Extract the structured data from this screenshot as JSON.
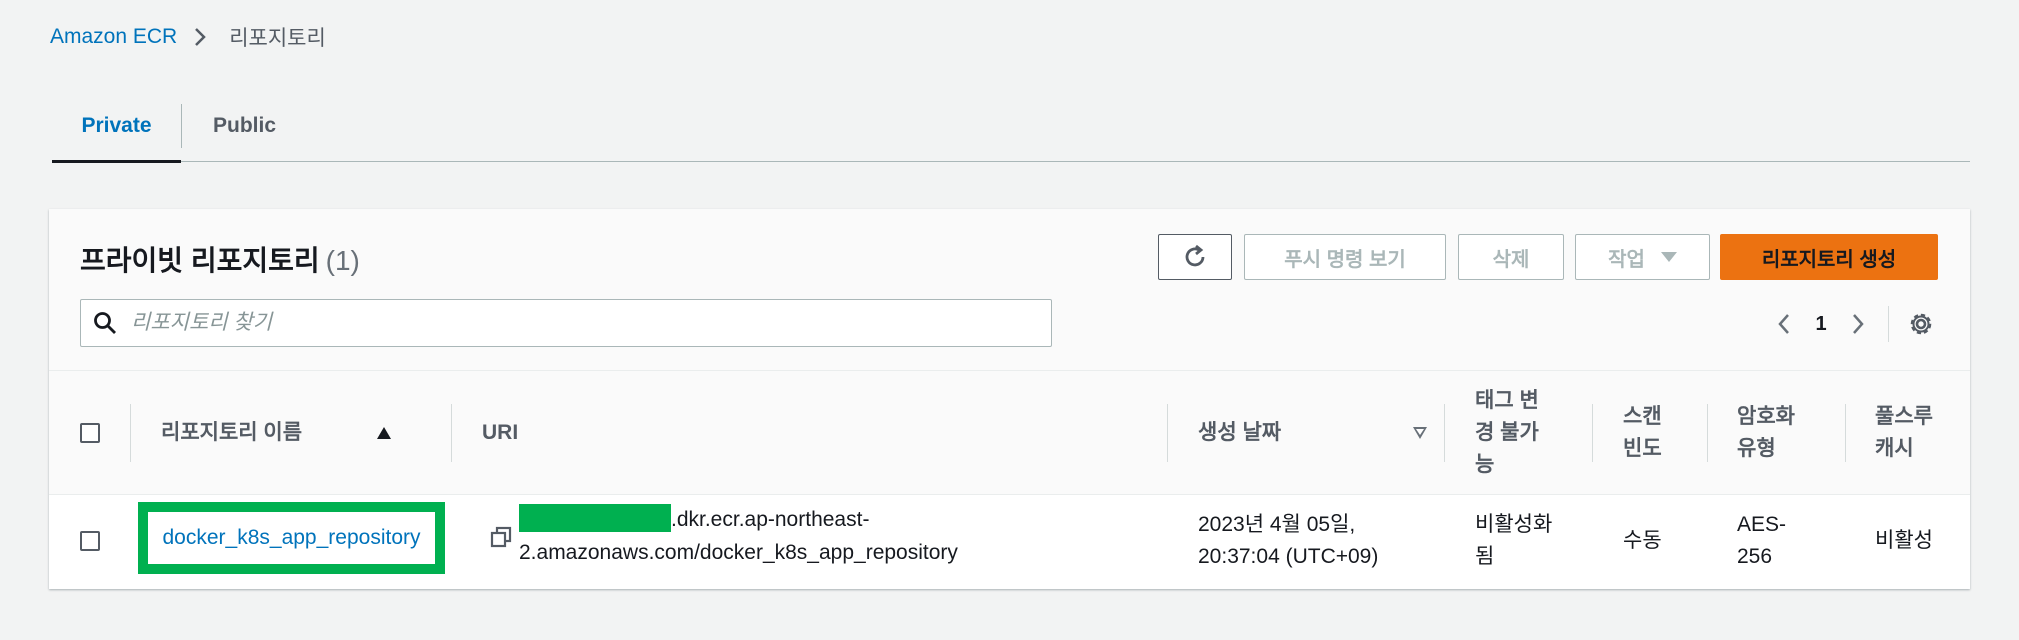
{
  "breadcrumb": {
    "root": "Amazon ECR",
    "current": "리포지토리"
  },
  "tabs": [
    {
      "label": "Private",
      "active": true
    },
    {
      "label": "Public",
      "active": false
    }
  ],
  "panel": {
    "title": "프라이빗 리포지토리",
    "count": "(1)",
    "buttons": {
      "push_commands": "푸시 명령 보기",
      "delete": "삭제",
      "actions": "작업",
      "create": "리포지토리 생성"
    },
    "search": {
      "placeholder": "리포지토리 찾기",
      "value": ""
    },
    "pagination": {
      "current_page": "1"
    }
  },
  "table": {
    "headers": {
      "name": "리포지토리 이름",
      "uri": "URI",
      "created": "생성 날짜",
      "tag_immutability": "태그 변경 불가능",
      "scan_frequency": "스캔 빈도",
      "encryption": "암호화 유형",
      "pull_through_cache": "풀스루 캐시"
    },
    "rows": [
      {
        "name": "docker_k8s_app_repository",
        "uri_line1_suffix": ".dkr.ecr.ap-northeast-",
        "uri_line2": "2.amazonaws.com/docker_k8s_app_repository",
        "created_line1": "2023년 4월 05일,",
        "created_line2": "20:37:04 (UTC+09)",
        "tag_immutability": "비활성화됨",
        "scan_frequency": "수동",
        "encryption": "AES-256",
        "pull_through_cache": "비활성"
      }
    ]
  },
  "colors": {
    "link": "#0073bb",
    "primary_button": "#ec7211",
    "highlight_box": "#00b050",
    "redaction": "#00b050",
    "page_background": "#f2f3f3"
  }
}
